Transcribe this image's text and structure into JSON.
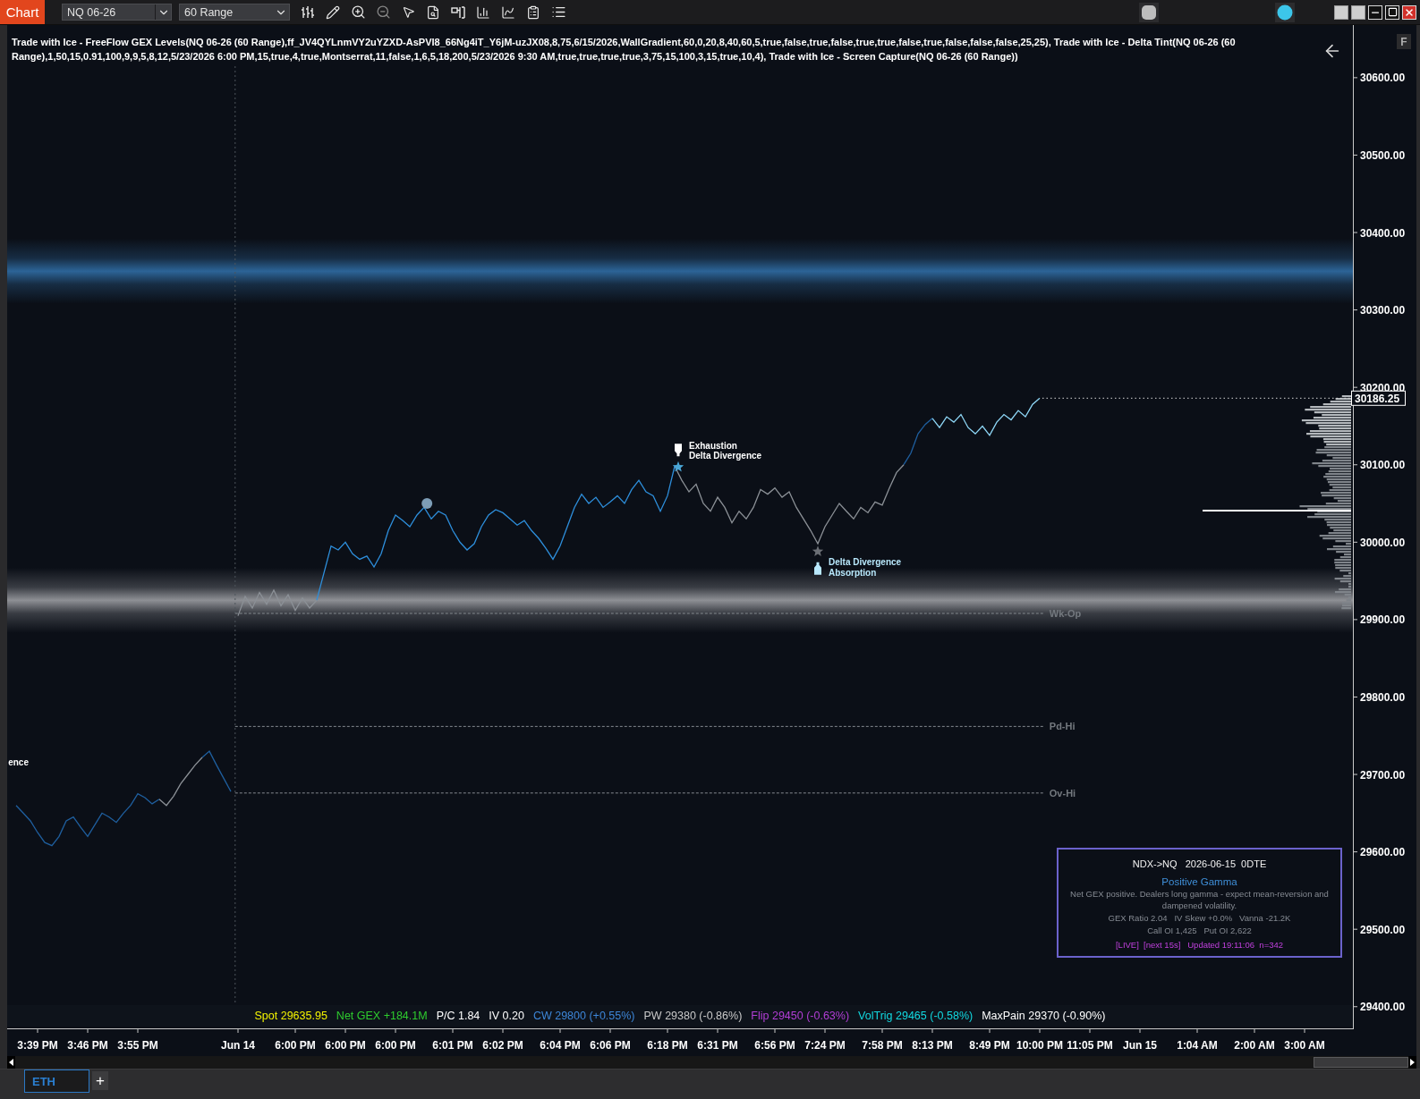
{
  "toolbar": {
    "tab": "Chart",
    "instrument": "NQ 06-26",
    "interval": "60 Range"
  },
  "indicator_header": "Trade with Ice - FreeFlow GEX Levels(NQ 06-26 (60 Range),ff_JV4QYLnmVY2uYZXD-AsPVI8_66Ng4iT_Y6jM-uzJX08,8,75,6/15/2026,WallGradient,60,0,20,8,40,60,5,true,false,true,false,true,true,false,true,false,false,false,25,25), Trade with Ice - Delta Tint(NQ 06-26 (60 Range),1,50,15,0.91,100,9,9,5,8,12,5/23/2026 6:00 PM,15,true,4,true,Montserrat,11,false,1,6,5,18,200,5/23/2026 9:30 AM,true,true,true,true,3,75,15,100,3,15,true,10,4), Trade with Ice - Screen Capture(NQ 06-26 (60 Range))",
  "side_button": "F",
  "price_chart": {
    "price_tag": "30186.25",
    "chart_data": {
      "type": "line",
      "categories": [
        null,
        null,
        null,
        "3:39 PM",
        null,
        null,
        null,
        null,
        null,
        null,
        "3:46 PM",
        null,
        null,
        null,
        null,
        null,
        null,
        "3:55 PM",
        null,
        null,
        null,
        null,
        null,
        null,
        null,
        null,
        null,
        null,
        null,
        null,
        null,
        "Jun 14",
        null,
        null,
        null,
        null,
        null,
        null,
        null,
        "6:00 PM",
        null,
        null,
        null,
        null,
        null,
        null,
        "6:00 PM",
        null,
        null,
        null,
        null,
        null,
        null,
        "6:00 PM",
        null,
        null,
        null,
        null,
        null,
        null,
        null,
        "6:01 PM",
        null,
        null,
        null,
        null,
        null,
        null,
        "6:02 PM",
        null,
        null,
        null,
        null,
        null,
        null,
        null,
        "6:04 PM",
        null,
        null,
        null,
        null,
        null,
        null,
        "6:06 PM",
        null,
        null,
        null,
        null,
        null,
        null,
        null,
        "6:18 PM",
        null,
        null,
        null,
        null,
        null,
        null,
        "6:31 PM",
        null,
        null,
        null,
        null,
        null,
        null,
        null,
        "6:56 PM",
        null,
        null,
        null,
        null,
        null,
        null,
        "7:24 PM",
        null,
        null,
        null,
        null,
        null,
        null,
        null,
        "7:58 PM",
        null,
        null,
        null,
        null,
        null,
        null,
        "8:13 PM",
        null,
        null,
        null,
        null,
        null,
        null,
        null,
        "8:49 PM",
        null,
        null,
        null,
        null,
        null,
        null,
        "10:00 PM",
        null,
        null,
        null,
        null,
        null,
        null,
        "11:05 PM",
        null,
        null,
        null,
        null,
        null,
        null,
        "Jun 15",
        null,
        null,
        null,
        null,
        null,
        null,
        null,
        "1:04 AM",
        null,
        null,
        null,
        null,
        null,
        null,
        null,
        "2:00 AM",
        null,
        null,
        null,
        null,
        null,
        null,
        "3:00 AM",
        null
      ],
      "ylim": [
        29372,
        30668
      ],
      "yticks": [
        {
          "value": 30600,
          "label": "30600.00"
        },
        {
          "value": 30500,
          "label": "30500.00"
        },
        {
          "value": 30400,
          "label": "30400.00"
        },
        {
          "value": 30300,
          "label": "30300.00"
        },
        {
          "value": 30200,
          "label": "30200.00"
        },
        {
          "value": 30100,
          "label": "30100.00"
        },
        {
          "value": 30000,
          "label": "30000.00"
        },
        {
          "value": 29900,
          "label": "29900.00"
        },
        {
          "value": 29800,
          "label": "29800.00"
        },
        {
          "value": 29700,
          "label": "29700.00"
        },
        {
          "value": 29600,
          "label": "29600.00"
        },
        {
          "value": 29500,
          "label": "29500.00"
        },
        {
          "value": 29400,
          "label": "29400.00"
        }
      ],
      "series": [
        {
          "color": "#1f5f9f",
          "values": [
            29660,
            29650,
            29640,
            29625,
            29612,
            29608,
            29620,
            29640,
            29645,
            29632,
            29620,
            29635,
            29650,
            29645,
            29638,
            29650,
            29660,
            29675,
            29670,
            29662,
            29668,
            null,
            null,
            null,
            null,
            null,
            29722,
            29730,
            29712,
            29695,
            29678,
            null,
            null,
            null,
            null,
            null,
            null,
            null,
            null,
            null,
            null,
            null,
            null,
            null,
            null,
            null,
            null,
            null,
            null,
            null,
            null,
            null,
            null,
            null,
            null,
            null,
            null,
            null,
            null,
            null,
            null,
            null,
            null,
            null,
            null,
            null,
            null,
            null,
            null,
            null,
            null,
            null,
            null,
            null,
            null,
            null,
            null,
            null,
            null,
            null,
            null,
            null,
            null,
            null,
            null,
            null,
            null,
            null,
            null,
            null,
            null,
            null,
            null,
            null,
            null,
            null,
            null,
            null,
            null,
            null,
            null,
            null,
            null,
            null,
            null,
            null,
            null,
            null,
            null,
            null,
            null,
            null,
            null,
            null,
            null,
            null,
            null,
            null,
            null,
            null,
            null,
            null,
            null,
            null,
            30100,
            30115,
            30140,
            30152,
            30160,
            null,
            null,
            null,
            null,
            null,
            null,
            null,
            null,
            null,
            null,
            null,
            null,
            null,
            null,
            null,
            null,
            null,
            null,
            null,
            null,
            null,
            null,
            null,
            null,
            null,
            null,
            null,
            null,
            null,
            null,
            null,
            null,
            null,
            null,
            null,
            null,
            null,
            null,
            null,
            null,
            null,
            null,
            null,
            null,
            null,
            null,
            null,
            null,
            null,
            null,
            null,
            null,
            null
          ]
        },
        {
          "color": "#8c9197",
          "values": [
            null,
            null,
            null,
            null,
            null,
            null,
            null,
            null,
            null,
            null,
            null,
            null,
            null,
            null,
            null,
            null,
            null,
            null,
            null,
            null,
            29668,
            29660,
            29672,
            29688,
            29700,
            29712,
            29722,
            null,
            null,
            null,
            null,
            29905,
            29930,
            29915,
            29935,
            29920,
            29938,
            29918,
            29932,
            29912,
            29928,
            29915,
            29925,
            null,
            null,
            null,
            null,
            null,
            null,
            null,
            null,
            null,
            null,
            null,
            null,
            null,
            null,
            null,
            null,
            null,
            null,
            null,
            null,
            null,
            null,
            null,
            null,
            null,
            null,
            null,
            null,
            null,
            null,
            null,
            null,
            null,
            null,
            null,
            null,
            null,
            null,
            null,
            null,
            null,
            null,
            null,
            null,
            null,
            null,
            null,
            null,
            null,
            30098,
            30080,
            30065,
            30075,
            30050,
            30040,
            30058,
            30045,
            30025,
            30040,
            30030,
            30045,
            30068,
            30062,
            30070,
            30058,
            30065,
            30045,
            30030,
            30015,
            29998,
            30020,
            30035,
            30050,
            30040,
            30030,
            30045,
            30038,
            30052,
            30048,
            30070,
            30090,
            30100,
            null,
            null,
            null,
            null,
            null,
            null,
            null,
            null,
            null,
            null,
            null,
            null,
            null,
            null,
            null,
            null,
            null,
            null,
            null,
            null,
            null,
            null,
            null,
            null,
            null,
            null,
            null,
            null,
            null,
            null,
            null,
            null,
            null,
            null,
            null,
            null,
            null,
            null,
            null,
            null,
            null,
            null,
            null,
            null,
            null,
            null,
            null,
            null,
            null,
            null,
            null,
            null,
            null,
            null,
            null,
            null,
            null
          ]
        },
        {
          "color": "#2e8fdc",
          "values": [
            null,
            null,
            null,
            null,
            null,
            null,
            null,
            null,
            null,
            null,
            null,
            null,
            null,
            null,
            null,
            null,
            null,
            null,
            null,
            null,
            null,
            null,
            null,
            null,
            null,
            null,
            null,
            null,
            null,
            null,
            null,
            null,
            null,
            null,
            null,
            null,
            null,
            null,
            null,
            null,
            null,
            null,
            29925,
            29960,
            29995,
            29990,
            30000,
            29985,
            29978,
            29982,
            29968,
            29985,
            30015,
            30035,
            30028,
            30020,
            30035,
            30045,
            30030,
            30040,
            30035,
            30015,
            30000,
            29990,
            29998,
            30020,
            30035,
            30042,
            30038,
            30030,
            30022,
            30028,
            30015,
            30005,
            29992,
            29978,
            29995,
            30020,
            30045,
            30062,
            30050,
            30058,
            30045,
            30052,
            30060,
            30050,
            30068,
            30080,
            30065,
            30060,
            30040,
            30060,
            30098,
            null,
            null,
            null,
            null,
            null,
            null,
            null,
            null,
            null,
            null,
            null,
            null,
            null,
            null,
            null,
            null,
            null,
            null,
            null,
            null,
            null,
            null,
            null,
            null,
            null,
            null,
            null,
            null,
            null,
            null,
            null,
            null,
            null,
            null,
            null,
            null,
            null,
            null,
            null,
            null,
            null,
            null,
            null,
            null,
            null,
            null,
            null,
            null,
            null,
            null,
            null,
            null,
            null,
            null,
            null,
            null,
            null,
            null,
            null,
            null,
            null,
            null,
            null,
            null,
            null,
            null,
            null,
            null,
            null,
            null,
            null,
            null,
            null,
            null,
            null,
            null,
            null,
            null,
            null,
            null,
            null,
            null,
            null,
            null,
            null,
            null,
            null,
            null,
            null
          ]
        },
        {
          "color": "#8fd8f8",
          "values": [
            null,
            null,
            null,
            null,
            null,
            null,
            null,
            null,
            null,
            null,
            null,
            null,
            null,
            null,
            null,
            null,
            null,
            null,
            null,
            null,
            null,
            null,
            null,
            null,
            null,
            null,
            null,
            null,
            null,
            null,
            null,
            null,
            null,
            null,
            null,
            null,
            null,
            null,
            null,
            null,
            null,
            null,
            null,
            null,
            null,
            null,
            null,
            null,
            null,
            null,
            null,
            null,
            null,
            null,
            null,
            null,
            null,
            null,
            null,
            null,
            null,
            null,
            null,
            null,
            null,
            null,
            null,
            null,
            null,
            null,
            null,
            null,
            null,
            null,
            null,
            null,
            null,
            null,
            null,
            null,
            null,
            null,
            null,
            null,
            null,
            null,
            null,
            null,
            null,
            null,
            null,
            null,
            null,
            null,
            null,
            null,
            null,
            null,
            null,
            null,
            null,
            null,
            null,
            null,
            null,
            null,
            null,
            null,
            null,
            null,
            null,
            null,
            null,
            null,
            null,
            null,
            null,
            null,
            null,
            null,
            null,
            null,
            null,
            null,
            null,
            null,
            null,
            null,
            30160,
            30148,
            30162,
            30155,
            30165,
            30148,
            30140,
            30150,
            30138,
            30155,
            30165,
            30158,
            30170,
            30162,
            30178,
            30186,
            null,
            null,
            null,
            null,
            null,
            null,
            null,
            null,
            null,
            null,
            null,
            null,
            null,
            null,
            null,
            null,
            null,
            null,
            null,
            null,
            null,
            null,
            null,
            null,
            null,
            null,
            null,
            null,
            null,
            null,
            null,
            null,
            null,
            null,
            null,
            null,
            null,
            null
          ]
        }
      ],
      "ref_lines": [
        {
          "axis": "y",
          "value": 29908,
          "label": "Wk-Op"
        },
        {
          "axis": "y",
          "value": 29762,
          "label": "Pd-Hi"
        },
        {
          "axis": "y",
          "value": 29676,
          "label": "Ov-Hi"
        }
      ],
      "bands": [
        {
          "axis": "y",
          "from": 30308,
          "to": 30392,
          "color": "#2c6497"
        },
        {
          "axis": "y",
          "from": 29883,
          "to": 29967,
          "color": "#8e9095"
        }
      ],
      "annotations": [
        "Exhaustion",
        "Delta Divergence",
        "Delta Divergence",
        "Absorption",
        "ence"
      ]
    }
  },
  "status_bar": [
    {
      "text": "Spot 29635.95",
      "color": "#f2f200"
    },
    {
      "text": "Net GEX +184.1M",
      "color": "#2ecc2e"
    },
    {
      "text": "P/C 1.84",
      "color": "#ffffff"
    },
    {
      "text": "IV 0.20",
      "color": "#ffffff"
    },
    {
      "text": "CW 29800 (+0.55%)",
      "color": "#3d86d8"
    },
    {
      "text": "PW 29380 (-0.86%)",
      "color": "#c8c8c8"
    },
    {
      "text": "Flip 29450 (-0.63%)",
      "color": "#b23ed6"
    },
    {
      "text": "VolTrig 29465 (-0.58%)",
      "color": "#12d8e0"
    },
    {
      "text": "MaxPain 29370 (-0.90%)",
      "color": "#ffffff"
    }
  ],
  "gex_panel": {
    "title": "NDX->NQ   2026-06-15  0DTE",
    "regime": "Positive Gamma",
    "description": "Net GEX positive. Dealers long gamma - expect mean-reversion and dampened volatility.",
    "stats": [
      "GEX Ratio 2.04   IV Skew +0.0%   Vanna -21.2K",
      "Call OI 1,425   Put OI 2,622"
    ],
    "footer": "[LIVE]  [next 15s]   Updated 19:11:06  n=342"
  },
  "tabs": [
    {
      "label": "ETH",
      "selected": true
    }
  ],
  "add_tab": "+"
}
